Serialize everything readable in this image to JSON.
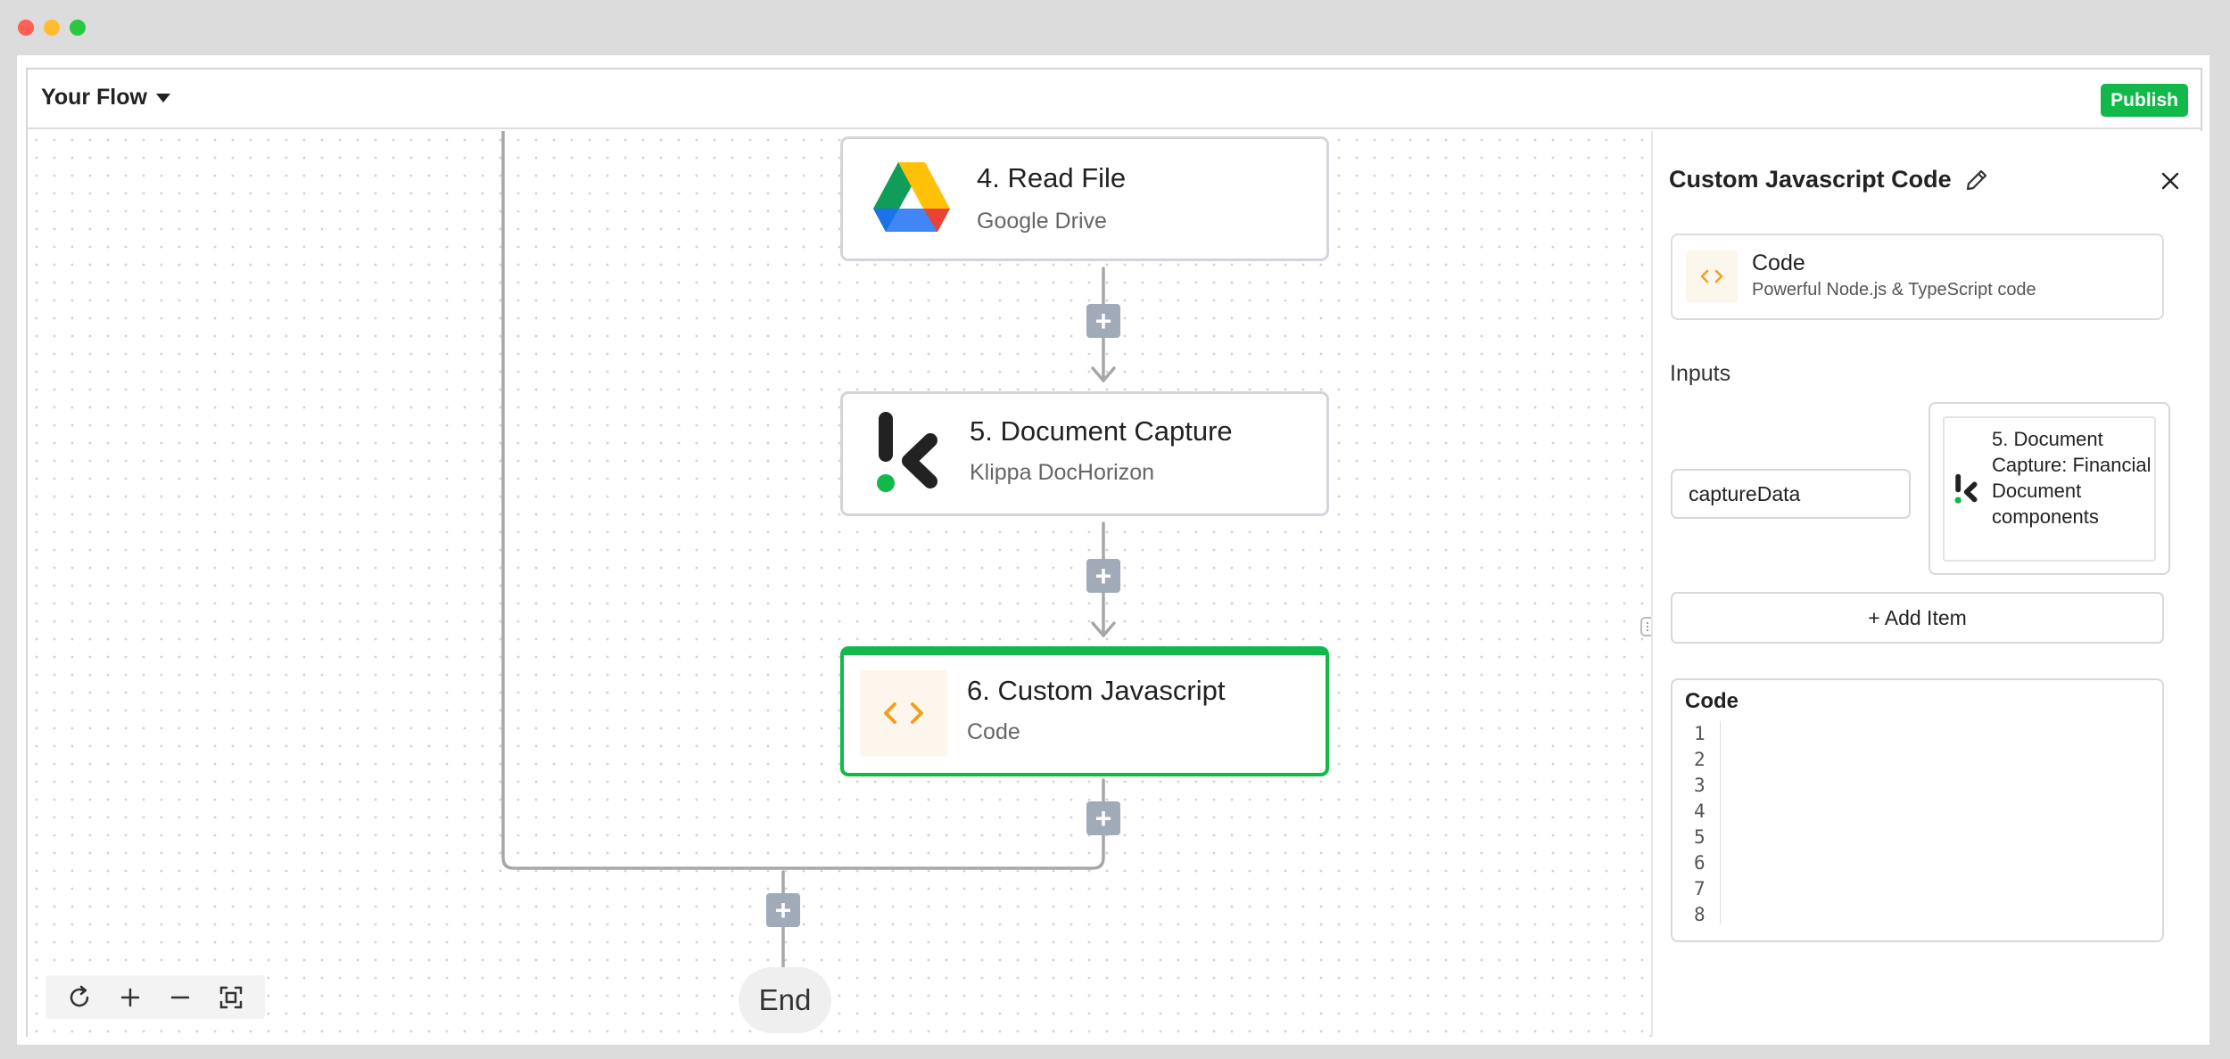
{
  "window_controls": {
    "close_color": "#ff5f57",
    "minimize_color": "#febc2e",
    "maximize_color": "#28c840"
  },
  "header": {
    "flow_title": "Your Flow",
    "publish_label": "Publish"
  },
  "colors": {
    "accent": "#12b94a",
    "plus_button": "#a0aab9",
    "code_icon": "#f0a020"
  },
  "canvas": {
    "nodes": [
      {
        "title": "4. Read File",
        "subtitle": "Google Drive",
        "icon": "google-drive-icon"
      },
      {
        "title": "5. Document Capture",
        "subtitle": "Klippa DocHorizon",
        "icon": "klippa-icon"
      },
      {
        "title": "6. Custom Javascript",
        "subtitle": "Code",
        "icon": "code-icon",
        "selected": true
      }
    ],
    "end_label": "End",
    "add_step_symbol": "+",
    "zoom_controls": [
      "reset-icon",
      "zoom-in-icon",
      "zoom-out-icon",
      "fit-view-icon"
    ]
  },
  "panel": {
    "title": "Custom Javascript Code",
    "piece": {
      "name": "Code",
      "description": "Powerful Node.js & TypeScript code"
    },
    "inputs_label": "Inputs",
    "input_key": "captureData",
    "input_value": "5. Document Capture: Financial Document components",
    "add_item_label": "+ Add Item",
    "code_label": "Code",
    "line_numbers": [
      "1",
      "2",
      "3",
      "4",
      "5",
      "6",
      "7",
      "8"
    ]
  }
}
